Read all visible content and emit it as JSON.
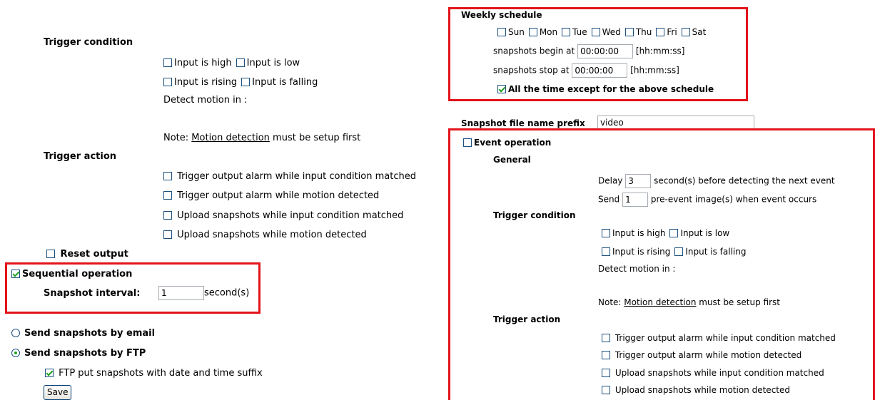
{
  "left": {
    "trigger_condition": {
      "heading": "Trigger condition",
      "input_high": "Input is high",
      "input_low": "Input is low",
      "input_rising": "Input is rising",
      "input_falling": "Input is falling",
      "detect_motion": "Detect motion in :",
      "note_prefix": "Note: ",
      "note_link": "Motion detection",
      "note_suffix": " must be setup first"
    },
    "trigger_action": {
      "heading": "Trigger action",
      "items": [
        "Trigger output alarm while input condition matched",
        "Trigger output alarm while motion detected",
        "Upload snapshots while input condition matched",
        "Upload snapshots while motion detected"
      ]
    },
    "reset_output": "Reset output",
    "sequential": {
      "label": "Sequential operation",
      "interval_label": "Snapshot interval:",
      "interval_value": "1",
      "unit": "second(s)"
    },
    "send_email": "Send snapshots by email",
    "send_ftp": "Send snapshots by FTP",
    "ftp_suffix": "FTP put snapshots with date and time suffix",
    "save": "Save"
  },
  "right": {
    "weekly": {
      "heading": "Weekly schedule",
      "days": [
        "Sun",
        "Mon",
        "Tue",
        "Wed",
        "Thu",
        "Fri",
        "Sat"
      ],
      "begin_label": "snapshots begin at",
      "begin_value": "00:00:00",
      "stop_label": "snapshots stop at",
      "stop_value": "00:00:00",
      "format": "[hh:mm:ss]",
      "except_label": "All the time except for the above schedule"
    },
    "prefix": {
      "label": "Snapshot file name prefix",
      "value": "video"
    },
    "event": {
      "label": "Event operation",
      "general": "General",
      "delay_label": "Delay",
      "delay_value": "3",
      "delay_suffix": "second(s) before detecting the next event",
      "send_label": "Send",
      "send_value": "1",
      "send_suffix": "pre-event image(s) when event occurs",
      "trigger_condition": "Trigger condition",
      "input_high": "Input is high",
      "input_low": "Input is low",
      "input_rising": "Input is rising",
      "input_falling": "Input is falling",
      "detect_motion": "Detect motion in :",
      "note_prefix": "Note: ",
      "note_link": "Motion detection",
      "note_suffix": " must be setup first",
      "trigger_action": "Trigger action",
      "actions": [
        "Trigger output alarm while input condition matched",
        "Trigger output alarm while motion detected",
        "Upload snapshots while input condition matched",
        "Upload snapshots while motion detected"
      ]
    }
  },
  "colors": {
    "highlight": "#e3131b",
    "check": "#21a121",
    "border": "#1c5180"
  }
}
